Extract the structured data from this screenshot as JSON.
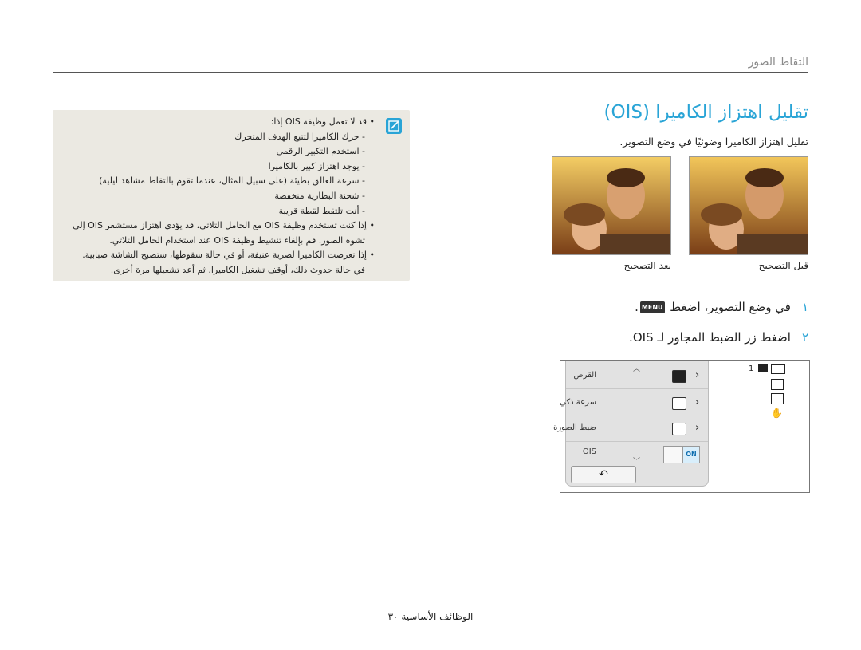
{
  "header": {
    "title": "التقاط الصور"
  },
  "section": {
    "title": "تقليل اهتزاز الكاميرا (OIS)"
  },
  "intro": "تقليل اهتزاز الكاميرا وضوئيًا في وضع التصوير.",
  "photos": {
    "before_caption": "قبل التصحيح",
    "after_caption": "بعد التصحيح"
  },
  "steps": [
    {
      "num": "١",
      "before": "في وضع التصوير، اضغط ",
      "menu_label": "MENU",
      "after": "."
    },
    {
      "num": "٢",
      "text": "اضغط زر الضبط المجاور لـ OIS."
    }
  ],
  "note": {
    "lines": [
      "قد لا تعمل وظيفة OIS إذا:",
      "- حرك الكاميرا لتتبع الهدف المتحرك",
      "- استخدم التكبير الرقمي",
      "- يوجد اهتزاز كبير بالكاميرا",
      "- سرعة الغالق بطيئة (على سبيل المثال، عندما تقوم بالتقاط مشاهد ليلية)",
      "- شحنة البطارية منخفضة",
      "- أنت تلتقط لقطة قريبة",
      "إذا كنت تستخدم وظيفة OIS مع الحامل الثلاثي، قد يؤدي اهتزاز مستشعر OIS إلى",
      "تشوه الصور. قم بإلغاء تنشيط وظيفة OIS عند استخدام الحامل الثلاثي.",
      "إذا تعرضت الكاميرا لضربة عنيفة، أو في حالة سقوطها، ستصبح الشاشة ضبابية.",
      "في حالة حدوث ذلك، أوقف تشغيل الكاميرا، ثم أعد تشغيلها مرة أخرى."
    ]
  },
  "screen": {
    "menu_items": [
      {
        "label": "القرص",
        "icon": "battery-rect-icon"
      },
      {
        "label": "سرعة ذكي",
        "icon": "smart-scene-icon"
      },
      {
        "label": "ضبط الصورة",
        "icon": "image-adjust-icon"
      },
      {
        "label": "OIS",
        "icon": "ois-toggle"
      }
    ],
    "toggle_label": "ON",
    "back_symbol": "↶",
    "status_count": "1"
  },
  "footer": {
    "page_text": "الوظائف الأساسية  ٣٠"
  }
}
